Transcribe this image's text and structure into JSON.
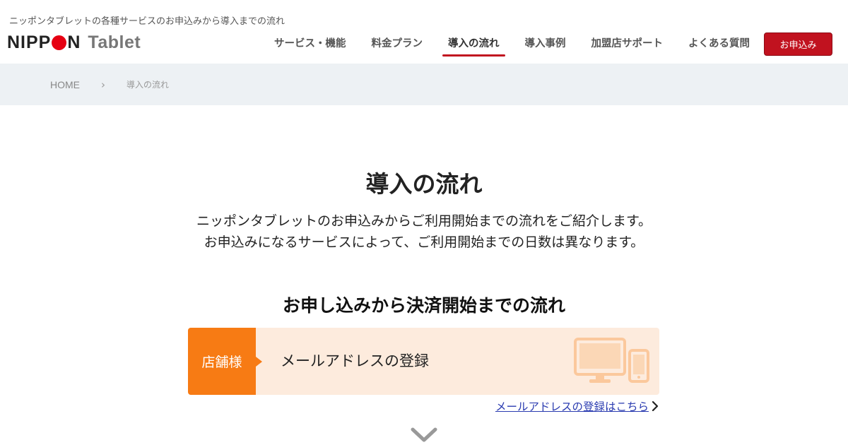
{
  "header": {
    "tagline": "ニッポンタブレットの各種サービスのお申込みから導入までの流れ",
    "logo": {
      "primary": "NIPPON",
      "secondary": "Tablet"
    },
    "nav": [
      {
        "label": "サービス・機能",
        "active": false
      },
      {
        "label": "料金プラン",
        "active": false
      },
      {
        "label": "導入の流れ",
        "active": true
      },
      {
        "label": "導入事例",
        "active": false
      },
      {
        "label": "加盟店サポート",
        "active": false
      },
      {
        "label": "よくある質問",
        "active": false
      }
    ],
    "apply_button": "お申込み"
  },
  "breadcrumb": {
    "home": "HOME",
    "separator": "›",
    "current": "導入の流れ"
  },
  "main": {
    "title": "導入の流れ",
    "intro": [
      "ニッポンタブレットのお申込みからご利用開始までの流れをご紹介します。",
      "お申込みになるサービスによって、ご利用開始までの日数は異なります。"
    ],
    "section_title": "お申し込みから決済開始までの流れ",
    "steps": [
      {
        "who": "店舗様",
        "label": "メールアドレスの登録",
        "icon": "devices-icon",
        "link": "メールアドレスの登録はこちら"
      }
    ]
  },
  "colors": {
    "accent_red": "#c1121f",
    "step_orange": "#f77b14",
    "step_bg": "#fdebdd",
    "breadcrumb_bg": "#edf1f4",
    "link_blue": "#2a3bb0"
  }
}
